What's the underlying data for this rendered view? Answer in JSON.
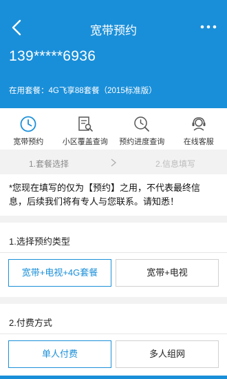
{
  "header": {
    "title": "宽带预约",
    "phone": "139*****6936",
    "plan": "在用套餐：4G飞享88套餐（2015标准版）"
  },
  "quick_links": [
    {
      "label": "宽带预约",
      "icon": "clock-icon"
    },
    {
      "label": "小区覆盖查询",
      "icon": "document-search-icon"
    },
    {
      "label": "预约进度查询",
      "icon": "clock-search-icon"
    },
    {
      "label": "在线客服",
      "icon": "headset-icon"
    }
  ],
  "steps": {
    "step1": "1.套餐选择",
    "step2": "2.信息填写"
  },
  "notice": "*您现在填写的仅为【预约】之用，不代表最终信息，后续我们将有专人与您联系。请知悉！",
  "section_type": {
    "title": "1.选择预约类型",
    "options": [
      "宽带+电视+4G套餐",
      "宽带+电视"
    ],
    "selected": "宽带+电视+4G套餐"
  },
  "section_pay": {
    "title": "2.付费方式",
    "options": [
      "单人付费",
      "多人组网"
    ],
    "selected": "单人付费"
  },
  "colors": {
    "primary": "#1a8fd9",
    "background": "#f2f2f2"
  }
}
